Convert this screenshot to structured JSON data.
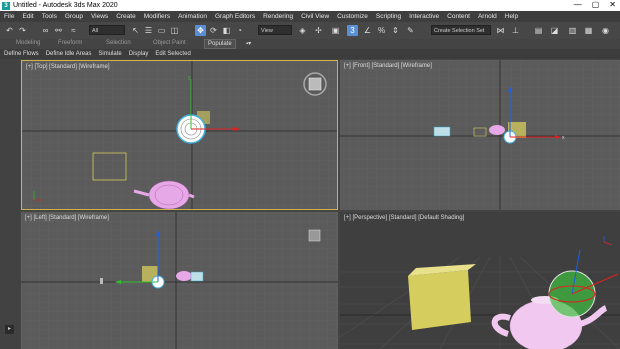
{
  "window": {
    "title": "Untitled - Autodesk 3ds Max 2020",
    "app_icon": "3ds-max-icon",
    "controls": [
      "—",
      "▢",
      "✕"
    ]
  },
  "menu": [
    "File",
    "Edit",
    "Tools",
    "Group",
    "Views",
    "Create",
    "Modifiers",
    "Animation",
    "Graph Editors",
    "Rendering",
    "Civil View",
    "Customize",
    "Scripting",
    "Interactive",
    "Content",
    "Arnold",
    "Help"
  ],
  "toolbar": {
    "filter_value": "All",
    "refcoord_value": "View",
    "angle_snap_label": "3",
    "selection_set_placeholder": "Create Selection Set"
  },
  "ribbon": {
    "tabs": [
      "Modeling",
      "Freeform",
      "Selection",
      "Object Paint"
    ],
    "populate_label": "Populate",
    "sub_items": [
      "Define Flows",
      "Define Idle Areas",
      "Simulate",
      "Display",
      "Edit Selected"
    ]
  },
  "viewports": {
    "top": {
      "label": "[+] [Top] [Standard] [Wireframe]"
    },
    "front": {
      "label": "[+] [Front] [Standard] [Wireframe]"
    },
    "left": {
      "label": "[+] [Left] [Standard] [Wireframe]"
    },
    "perspective": {
      "label": "[+] [Perspective] [Standard] [Default Shading]"
    }
  },
  "colors": {
    "selected_border": "#d0b24a",
    "teapot": "#e7a8e7",
    "box": "#d6cd5f",
    "axis_x": "#e02020",
    "axis_y": "#30c030",
    "axis_z": "#2060e0"
  }
}
